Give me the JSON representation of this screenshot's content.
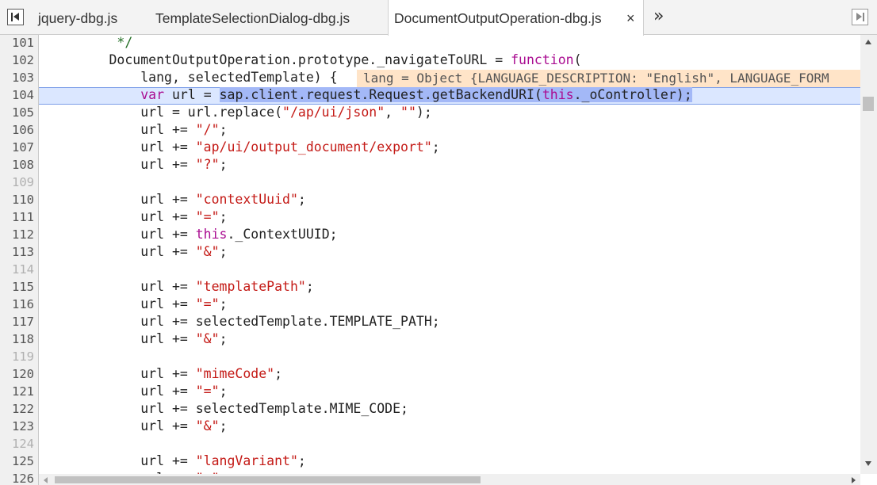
{
  "tabs": [
    {
      "label": "jquery-dbg.js",
      "active": false
    },
    {
      "label": "TemplateSelectionDialog-dbg.js",
      "active": false
    },
    {
      "label": "DocumentOutputOperation-dbg.js",
      "active": true
    }
  ],
  "icons": {
    "navigator_toggle": "navigator-toggle-icon",
    "close": "×",
    "more_tabs": "»",
    "debugger_toggle": "debugger-toggle-icon"
  },
  "colors": {
    "keyword": "#aa0d91",
    "string": "#c41a16",
    "comment": "#236e25",
    "selection": "#a3b8f7",
    "inline_value_bg": "#ffe4c8",
    "execution_line": "#dbe7ff"
  },
  "editor": {
    "current_line": 104,
    "inline_value": "lang = Object {LANGUAGE_DESCRIPTION: \"English\", LANGUAGE_FORM",
    "lines": [
      {
        "num": "101",
        "segs": [
          {
            "t": "         */",
            "c": "cmt"
          }
        ]
      },
      {
        "num": "102",
        "segs": [
          {
            "t": "        DocumentOutputOperation.prototype._navigateToURL = ",
            "c": ""
          },
          {
            "t": "function",
            "c": "kw"
          },
          {
            "t": "(",
            "c": ""
          }
        ]
      },
      {
        "num": "103",
        "segs": [
          {
            "t": "            lang, selectedTemplate) {",
            "c": ""
          }
        ]
      },
      {
        "num": "104",
        "segs": [
          {
            "t": "            ",
            "c": ""
          },
          {
            "t": "var",
            "c": "kw"
          },
          {
            "t": " url = ",
            "c": ""
          },
          {
            "t": "sap.client.request.Request.getBackendURI(",
            "c": "sel"
          },
          {
            "t": "this",
            "c": "kw sel"
          },
          {
            "t": "._oController);",
            "c": "sel"
          }
        ]
      },
      {
        "num": "105",
        "segs": [
          {
            "t": "            url = url.replace(",
            "c": ""
          },
          {
            "t": "\"/ap/ui/json\"",
            "c": "str"
          },
          {
            "t": ", ",
            "c": ""
          },
          {
            "t": "\"\"",
            "c": "str"
          },
          {
            "t": ");",
            "c": ""
          }
        ]
      },
      {
        "num": "106",
        "segs": [
          {
            "t": "            url += ",
            "c": ""
          },
          {
            "t": "\"/\"",
            "c": "str"
          },
          {
            "t": ";",
            "c": ""
          }
        ]
      },
      {
        "num": "107",
        "segs": [
          {
            "t": "            url += ",
            "c": ""
          },
          {
            "t": "\"ap/ui/output_document/export\"",
            "c": "str"
          },
          {
            "t": ";",
            "c": ""
          }
        ]
      },
      {
        "num": "108",
        "segs": [
          {
            "t": "            url += ",
            "c": ""
          },
          {
            "t": "\"?\"",
            "c": "str"
          },
          {
            "t": ";",
            "c": ""
          }
        ]
      },
      {
        "num": "109",
        "segs": []
      },
      {
        "num": "110",
        "segs": [
          {
            "t": "            url += ",
            "c": ""
          },
          {
            "t": "\"contextUuid\"",
            "c": "str"
          },
          {
            "t": ";",
            "c": ""
          }
        ]
      },
      {
        "num": "111",
        "segs": [
          {
            "t": "            url += ",
            "c": ""
          },
          {
            "t": "\"=\"",
            "c": "str"
          },
          {
            "t": ";",
            "c": ""
          }
        ]
      },
      {
        "num": "112",
        "segs": [
          {
            "t": "            url += ",
            "c": ""
          },
          {
            "t": "this",
            "c": "kw"
          },
          {
            "t": "._ContextUUID;",
            "c": ""
          }
        ]
      },
      {
        "num": "113",
        "segs": [
          {
            "t": "            url += ",
            "c": ""
          },
          {
            "t": "\"&\"",
            "c": "str"
          },
          {
            "t": ";",
            "c": ""
          }
        ]
      },
      {
        "num": "114",
        "segs": []
      },
      {
        "num": "115",
        "segs": [
          {
            "t": "            url += ",
            "c": ""
          },
          {
            "t": "\"templatePath\"",
            "c": "str"
          },
          {
            "t": ";",
            "c": ""
          }
        ]
      },
      {
        "num": "116",
        "segs": [
          {
            "t": "            url += ",
            "c": ""
          },
          {
            "t": "\"=\"",
            "c": "str"
          },
          {
            "t": ";",
            "c": ""
          }
        ]
      },
      {
        "num": "117",
        "segs": [
          {
            "t": "            url += selectedTemplate.TEMPLATE_PATH;",
            "c": ""
          }
        ]
      },
      {
        "num": "118",
        "segs": [
          {
            "t": "            url += ",
            "c": ""
          },
          {
            "t": "\"&\"",
            "c": "str"
          },
          {
            "t": ";",
            "c": ""
          }
        ]
      },
      {
        "num": "119",
        "segs": []
      },
      {
        "num": "120",
        "segs": [
          {
            "t": "            url += ",
            "c": ""
          },
          {
            "t": "\"mimeCode\"",
            "c": "str"
          },
          {
            "t": ";",
            "c": ""
          }
        ]
      },
      {
        "num": "121",
        "segs": [
          {
            "t": "            url += ",
            "c": ""
          },
          {
            "t": "\"=\"",
            "c": "str"
          },
          {
            "t": ";",
            "c": ""
          }
        ]
      },
      {
        "num": "122",
        "segs": [
          {
            "t": "            url += selectedTemplate.MIME_CODE;",
            "c": ""
          }
        ]
      },
      {
        "num": "123",
        "segs": [
          {
            "t": "            url += ",
            "c": ""
          },
          {
            "t": "\"&\"",
            "c": "str"
          },
          {
            "t": ";",
            "c": ""
          }
        ]
      },
      {
        "num": "124",
        "segs": []
      },
      {
        "num": "125",
        "segs": [
          {
            "t": "            url += ",
            "c": ""
          },
          {
            "t": "\"langVariant\"",
            "c": "str"
          },
          {
            "t": ";",
            "c": ""
          }
        ]
      },
      {
        "num": "126",
        "segs": [
          {
            "t": "            url += ",
            "c": ""
          },
          {
            "t": "\"=\"",
            "c": "str"
          },
          {
            "t": ";",
            "c": ""
          }
        ]
      }
    ]
  }
}
